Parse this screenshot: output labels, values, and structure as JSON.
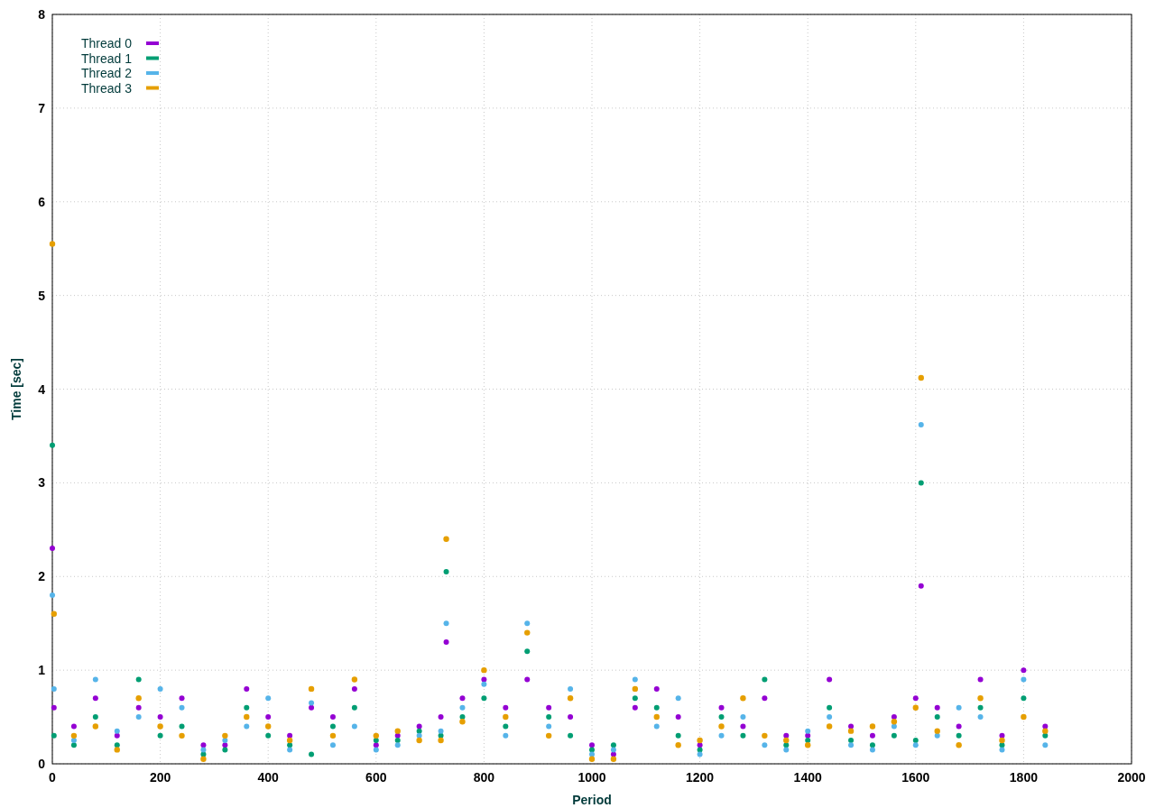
{
  "chart_data": {
    "type": "scatter",
    "xlabel": "Period",
    "ylabel": "Time [sec]",
    "xlim": [
      0,
      2000
    ],
    "ylim": [
      0,
      8
    ],
    "grid": true,
    "legend": "top-left",
    "xticks": [
      0,
      200,
      400,
      600,
      800,
      1000,
      1200,
      1400,
      1600,
      1800,
      2000
    ],
    "yticks": [
      0,
      1,
      2,
      3,
      4,
      5,
      6,
      7,
      8
    ],
    "x": [
      0,
      3,
      40,
      80,
      120,
      160,
      200,
      240,
      280,
      320,
      360,
      400,
      440,
      480,
      520,
      560,
      600,
      640,
      680,
      720,
      730,
      760,
      800,
      840,
      880,
      920,
      960,
      1000,
      1040,
      1080,
      1120,
      1160,
      1200,
      1240,
      1280,
      1320,
      1360,
      1400,
      1440,
      1480,
      1520,
      1560,
      1600,
      1610,
      1640,
      1680,
      1720,
      1760,
      1800,
      1840
    ],
    "series": [
      {
        "name": "Thread 0",
        "color": "#9400d3",
        "values": [
          2.3,
          0.6,
          0.4,
          0.7,
          0.3,
          0.6,
          0.5,
          0.7,
          0.2,
          0.2,
          0.8,
          0.5,
          0.3,
          0.6,
          0.5,
          0.8,
          0.2,
          0.3,
          0.4,
          0.5,
          1.3,
          0.7,
          0.9,
          0.6,
          0.9,
          0.6,
          0.5,
          0.2,
          0.1,
          0.6,
          0.8,
          0.5,
          0.2,
          0.6,
          0.4,
          0.7,
          0.3,
          0.3,
          0.9,
          0.4,
          0.3,
          0.5,
          0.7,
          1.9,
          0.6,
          0.4,
          0.9,
          0.3,
          1.0,
          0.4
        ]
      },
      {
        "name": "Thread 1",
        "color": "#009e73",
        "values": [
          3.4,
          0.3,
          0.2,
          0.5,
          0.2,
          0.9,
          0.3,
          0.4,
          0.1,
          0.15,
          0.6,
          0.3,
          0.2,
          0.1,
          0.4,
          0.6,
          0.25,
          0.25,
          0.35,
          0.3,
          2.05,
          0.5,
          0.7,
          0.4,
          1.2,
          0.5,
          0.3,
          0.15,
          0.2,
          0.7,
          0.6,
          0.3,
          0.15,
          0.5,
          0.3,
          0.9,
          0.2,
          0.25,
          0.6,
          0.25,
          0.2,
          0.3,
          0.25,
          3.0,
          0.5,
          0.3,
          0.6,
          0.2,
          0.7,
          0.3
        ]
      },
      {
        "name": "Thread 2",
        "color": "#56b4e9",
        "values": [
          1.8,
          0.8,
          0.25,
          0.9,
          0.35,
          0.5,
          0.8,
          0.6,
          0.15,
          0.25,
          0.4,
          0.7,
          0.15,
          0.65,
          0.2,
          0.4,
          0.15,
          0.2,
          0.3,
          0.35,
          1.5,
          0.6,
          0.85,
          0.3,
          1.5,
          0.4,
          0.8,
          0.1,
          0.15,
          0.9,
          0.4,
          0.7,
          0.1,
          0.3,
          0.5,
          0.2,
          0.15,
          0.35,
          0.5,
          0.2,
          0.15,
          0.4,
          0.2,
          3.62,
          0.3,
          0.6,
          0.5,
          0.15,
          0.9,
          0.2
        ]
      },
      {
        "name": "Thread 3",
        "color": "#e69f00",
        "values": [
          5.55,
          1.6,
          0.3,
          0.4,
          0.15,
          0.7,
          0.4,
          0.3,
          0.05,
          0.3,
          0.5,
          0.4,
          0.25,
          0.8,
          0.3,
          0.9,
          0.3,
          0.35,
          0.25,
          0.25,
          2.4,
          0.45,
          1.0,
          0.5,
          1.4,
          0.3,
          0.7,
          0.05,
          0.05,
          0.8,
          0.5,
          0.2,
          0.25,
          0.4,
          0.7,
          0.3,
          0.25,
          0.2,
          0.4,
          0.35,
          0.4,
          0.45,
          0.6,
          4.12,
          0.35,
          0.2,
          0.7,
          0.25,
          0.5,
          0.35
        ]
      }
    ]
  }
}
